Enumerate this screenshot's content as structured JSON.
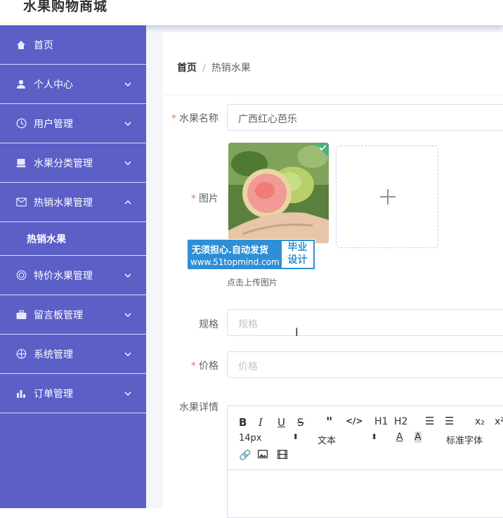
{
  "header": {
    "title": "水果购物商城"
  },
  "sidebar": {
    "items": [
      {
        "label": "首页",
        "icon": "home-icon",
        "arrow": ""
      },
      {
        "label": "个人中心",
        "icon": "user-icon",
        "arrow": "down"
      },
      {
        "label": "用户管理",
        "icon": "clock-icon",
        "arrow": "down"
      },
      {
        "label": "水果分类管理",
        "icon": "monitor-icon",
        "arrow": "down"
      },
      {
        "label": "热销水果管理",
        "icon": "mail-icon",
        "arrow": "up"
      },
      {
        "label": "特价水果管理",
        "icon": "target-icon",
        "arrow": "down"
      },
      {
        "label": "留言板管理",
        "icon": "briefcase-icon",
        "arrow": "down"
      },
      {
        "label": "系统管理",
        "icon": "compass-icon",
        "arrow": "down"
      },
      {
        "label": "订单管理",
        "icon": "bar-chart-icon",
        "arrow": "down"
      }
    ],
    "submenu": {
      "label": "热销水果"
    }
  },
  "breadcrumb": {
    "home": "首页",
    "separator": "/",
    "current": "热销水果"
  },
  "form": {
    "name": {
      "label": "水果名称",
      "value": "广西红心芭乐"
    },
    "image": {
      "label": "图片",
      "tip": "点击上传图片"
    },
    "spec": {
      "label": "规格",
      "placeholder": "规格"
    },
    "price": {
      "label": "价格",
      "placeholder": "价格"
    },
    "detail": {
      "label": "水果详情"
    }
  },
  "watermark": {
    "line1": "无须担心.自动发货",
    "line2": "www.51topmind.com",
    "badge1": "毕业",
    "badge2": "设计"
  },
  "editor": {
    "font_size": "14px",
    "text_style": "文本",
    "font_family": "标准字体",
    "h1": "H1",
    "h2": "H2",
    "sub": "x₂",
    "sup": "x²"
  },
  "colors": {
    "sidebar": "#5b5fc6",
    "accent": "#f56c6c",
    "watermark": "#2f8fd6"
  }
}
